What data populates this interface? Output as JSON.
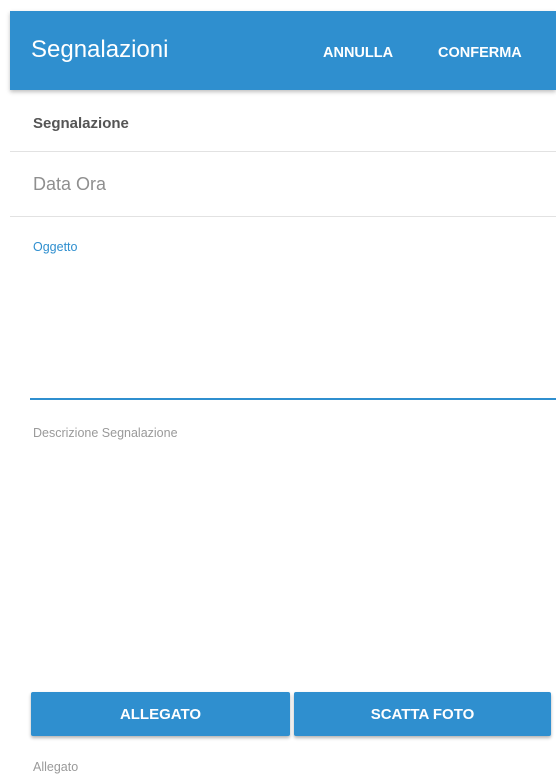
{
  "appbar": {
    "title": "Segnalazioni",
    "cancel_label": "ANNULLA",
    "confirm_label": "CONFERMA",
    "color": "#2f8fcf"
  },
  "form": {
    "section_header": "Segnalazione",
    "data_ora": {
      "placeholder": "Data Ora",
      "value": ""
    },
    "oggetto": {
      "label": "Oggetto",
      "value": ""
    },
    "descrizione": {
      "placeholder": "Descrizione Segnalazione",
      "value": ""
    },
    "buttons": {
      "allegato_label": "ALLEGATO",
      "scatta_foto_label": "SCATTA FOTO"
    },
    "allegato_label": "Allegato"
  }
}
